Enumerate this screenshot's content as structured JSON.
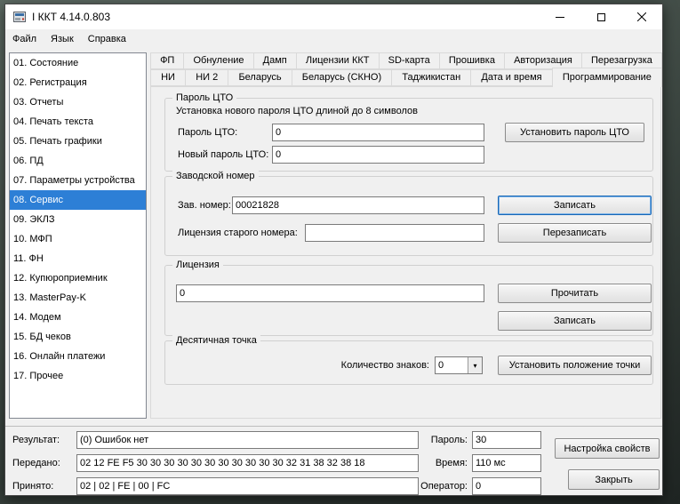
{
  "colors": {
    "selection": "#2d7fd6",
    "focus": "#1867b5"
  },
  "icons": {
    "dropdown_arrow": "▾"
  },
  "window": {
    "title": "I ККТ 4.14.0.803"
  },
  "menubar": {
    "items": [
      "Файл",
      "Язык",
      "Справка"
    ]
  },
  "sidebar": {
    "items": [
      {
        "label": "01. Состояние"
      },
      {
        "label": "02. Регистрация"
      },
      {
        "label": "03. Отчеты"
      },
      {
        "label": "04. Печать текста"
      },
      {
        "label": "05. Печать графики"
      },
      {
        "label": "06. ПД"
      },
      {
        "label": "07. Параметры устройства"
      },
      {
        "label": "08. Сервис",
        "selected": true
      },
      {
        "label": "09. ЭКЛЗ"
      },
      {
        "label": "10. МФП"
      },
      {
        "label": "11. ФН"
      },
      {
        "label": "12. Купюроприемник"
      },
      {
        "label": "13. MasterPay-K"
      },
      {
        "label": "14. Модем"
      },
      {
        "label": "15. БД чеков"
      },
      {
        "label": "16. Онлайн платежи"
      },
      {
        "label": "17. Прочее"
      }
    ]
  },
  "tabs": {
    "row1": [
      {
        "label": "ФП"
      },
      {
        "label": "Обнуление"
      },
      {
        "label": "Дамп"
      },
      {
        "label": "Лицензии ККТ"
      },
      {
        "label": "SD-карта"
      },
      {
        "label": "Прошивка"
      },
      {
        "label": "Авторизация"
      },
      {
        "label": "Перезагрузка"
      }
    ],
    "row2": [
      {
        "label": "НИ"
      },
      {
        "label": "НИ 2"
      },
      {
        "label": "Беларусь"
      },
      {
        "label": "Беларусь (СКНО)"
      },
      {
        "label": "Таджикистан"
      },
      {
        "label": "Дата и время"
      },
      {
        "label": "Программирование",
        "active": true
      }
    ]
  },
  "cto": {
    "title": "Пароль ЦТО",
    "note": "Установка нового пароля ЦТО длиной до 8 символов",
    "password_label": "Пароль ЦТО:",
    "password_value": "0",
    "new_password_label": "Новый пароль ЦТО:",
    "new_password_value": "0",
    "set_button": "Установить пароль ЦТО"
  },
  "serial": {
    "title": "Заводской номер",
    "number_label": "Зав. номер:",
    "number_value": "00021828",
    "write_button": "Записать",
    "old_license_label": "Лицензия старого номера:",
    "old_license_value": "",
    "rewrite_button": "Перезаписать"
  },
  "license": {
    "title": "Лицензия",
    "value": "0",
    "read_button": "Прочитать",
    "write_button": "Записать"
  },
  "decimal": {
    "title": "Десятичная точка",
    "digits_label": "Количество знаков:",
    "digits_value": "0",
    "set_button": "Установить положение точки"
  },
  "status": {
    "result_label": "Результат:",
    "result_value": "(0) Ошибок нет",
    "sent_label": "Передано:",
    "sent_value": "02 12 FE F5 30 30 30 30 30 30 30 30 30 30 30 32 31 38 32 38 18",
    "received_label": "Принято:",
    "received_value": "02 | 02 | FE | 00 | FC",
    "password_label": "Пароль:",
    "password_value": "30",
    "time_label": "Время:",
    "time_value": "110 мс",
    "operator_label": "Оператор:",
    "operator_value": "0",
    "properties_button": "Настройка свойств",
    "close_button": "Закрыть"
  }
}
